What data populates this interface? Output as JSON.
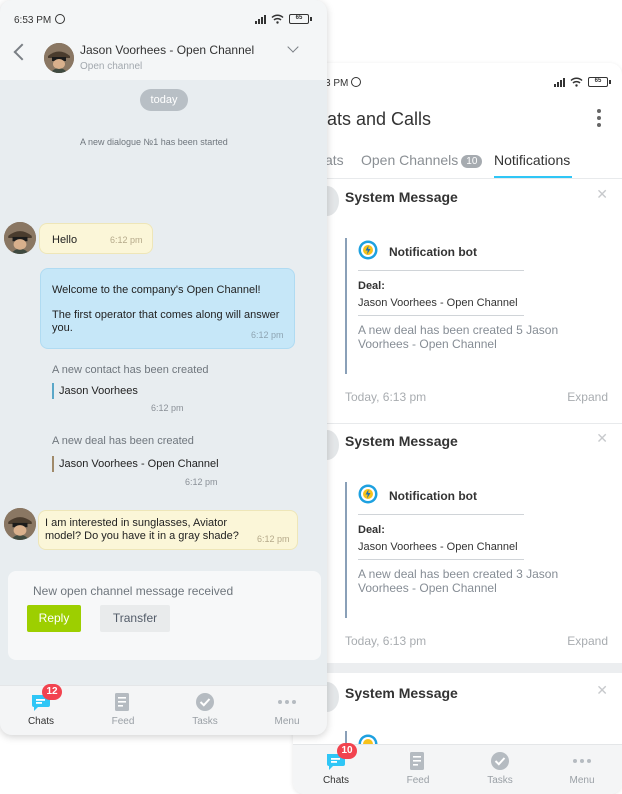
{
  "back_screen": {
    "status": {
      "time": "3 PM",
      "battery": "65"
    },
    "title": "ats and Calls",
    "tabs": [
      {
        "label": "ats"
      },
      {
        "label": "Open Channels",
        "count": "10"
      },
      {
        "label": "Notifications"
      }
    ],
    "notifications": [
      {
        "title": "System Message",
        "bot_name": "Notification  bot",
        "deal_label": "Deal:",
        "deal_name": "Jason Voorhees - Open Channel",
        "text": "A new deal has been created 5 Jason Voorhees - Open Channel",
        "time": "Today, 6:13 pm",
        "expand": "Expand"
      },
      {
        "title": "System Message",
        "bot_name": "Notification  bot",
        "deal_label": "Deal:",
        "deal_name": "Jason Voorhees - Open Channel",
        "text": "A new deal has been created 3 Jason Voorhees - Open Channel",
        "time": "Today, 6:13 pm",
        "expand": "Expand"
      },
      {
        "title": "System Message"
      }
    ],
    "tabbar": [
      {
        "label": "Chats",
        "badge": "10"
      },
      {
        "label": "Feed"
      },
      {
        "label": "Tasks"
      },
      {
        "label": "Menu"
      }
    ]
  },
  "front_screen": {
    "status": {
      "time": "6:53 PM",
      "battery": "65"
    },
    "header": {
      "title": "Jason Voorhees - Open Channel",
      "subtitle": "Open channel"
    },
    "date_pill": "today",
    "dialogue_started": "A new dialogue №1 has been started",
    "messages": [
      {
        "text": "Hello",
        "time": "6:12 pm"
      },
      {
        "line1": "Welcome to the company's Open Channel!",
        "line2": "The first operator that comes along will answer you.",
        "time": "6:12 pm"
      }
    ],
    "contact_created": {
      "label": "A new contact has been created",
      "value": "Jason Voorhees",
      "time": "6:12 pm"
    },
    "deal_created": {
      "label": "A new deal has been created",
      "value": "Jason Voorhees - Open Channel",
      "time": "6:12 pm"
    },
    "client_message": {
      "text": "I am interested in sunglasses, Aviator model? Do you have it in a gray shade?",
      "time": "6:12 pm"
    },
    "reply_card": {
      "title": "New open channel message received",
      "reply": "Reply",
      "transfer": "Transfer"
    },
    "tabbar": [
      {
        "label": "Chats",
        "badge": "12"
      },
      {
        "label": "Feed"
      },
      {
        "label": "Tasks"
      },
      {
        "label": "Menu"
      }
    ]
  },
  "colors": {
    "accent": "#2fc6f6",
    "reply_green": "#9dcf00",
    "badge_red": "#f2434f",
    "chat_icon_blue": "#2fc6f6"
  }
}
